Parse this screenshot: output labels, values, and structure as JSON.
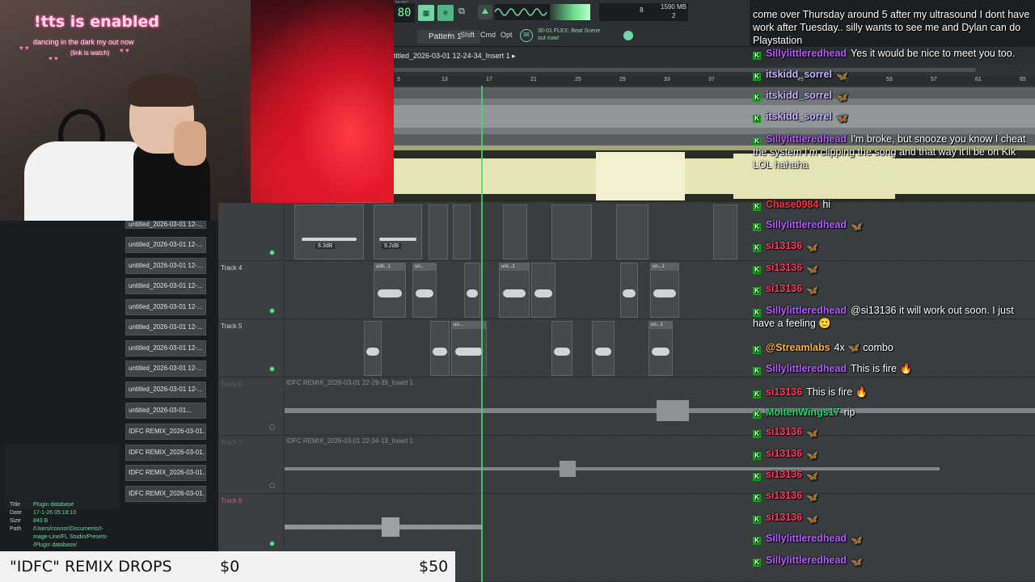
{
  "webcam": {
    "tts_title": "!tts is enabled",
    "tts_sub1": "dancing in the dark my out now",
    "tts_sub2": "(link is watch)"
  },
  "toolbar": {
    "tempo_caption": "MUSIC",
    "tempo": "80",
    "cpu_value": "8",
    "mem_value": "1590 MB",
    "voices_value": "2",
    "pattern_label": "Pattern 1",
    "pattern_add": "+",
    "shift_label": "Shift",
    "cmd_label": "Cmd",
    "opt_label": "Opt",
    "news_line1": "30-01  FLEX: Beat Scene",
    "news_line2": "out now!"
  },
  "playlist": {
    "title": "titled_2026-03-01 12-24-34_Insert 1 ▸",
    "ruler_ticks": [
      "9",
      "13",
      "17",
      "21",
      "25",
      "29",
      "33",
      "37",
      "41",
      "45",
      "49",
      "53",
      "57",
      "61",
      "65"
    ],
    "track_labels": [
      "Track 4",
      "Track 5",
      "Track 6",
      "Track 7",
      "Track 8"
    ],
    "clip_db1": "8.3dB",
    "clip_db2": "9.2dB",
    "clip_short1": "unti...1",
    "clip_short2": "un...",
    "clip_short3": "unt...1",
    "clip_short4": "un...1",
    "long_clip1": "IDFC REMIX_2026-03-01 22-29-39_Insert 1",
    "long_clip2": "IDFC REMIX_2026-03-01 22-34-13_Insert 1"
  },
  "browser": {
    "files": [
      "untitled_2026-03-01 12-...",
      "untitled_2026-03-01 12-...",
      "untitled_2026-03-01 12-...",
      "untitled_2026-03-01 12-...",
      "untitled_2026-03-01 12-...",
      "untitled_2026-03-01 12-...",
      "untitled_2026-03-01 12-...",
      "untitled_2026-03-01 12-...",
      "untitled_2026-03-01 12-...",
      "untitled_2026-03-01...",
      "IDFC REMIX_2026-03-01...",
      "IDFC REMIX_2026-03-01...",
      "IDFC REMIX_2026-03-01...",
      "IDFC REMIX_2026-03-01..."
    ],
    "meta_title_k": "Title",
    "meta_title_v": "Plugin database",
    "meta_date_k": "Date",
    "meta_date_v": "17-1-26 05:18:10",
    "meta_size_k": "Size",
    "meta_size_v": "843 B",
    "meta_path_k": "Path",
    "meta_path_v1": "/Users/connor/Documents/I-",
    "meta_path_v2": "mage-Line/FL Studio/Presets-",
    "meta_path_v3": "/Plugin database/"
  },
  "goal": {
    "title": "\"IDFC\" REMIX DROPS",
    "low": "$0",
    "high": "$50"
  },
  "chat": {
    "messages": [
      {
        "user": "",
        "text": "come over Thursday around 5 after my ultrasound I dont have work after Tuesday.. silly wants to see me and Dylan can do Playstation",
        "color": "#ffffff"
      },
      {
        "user": "Sillylittleredhead",
        "text": "Yes it would be nice to meet you too.",
        "color": "#b45cff"
      },
      {
        "user": "itskidd_sorrel",
        "text": "",
        "color": "#c7b3ff"
      },
      {
        "user": "itskidd_sorrel",
        "text": "",
        "color": "#c7b3ff"
      },
      {
        "user": "itskidd_sorrel",
        "text": "",
        "color": "#c7b3ff"
      },
      {
        "user": "Sillylittleredhead",
        "text": "I'm broke, but snooze you know I cheat the system I'm clipping the song and that way it'll be on Kik LOL hahaha",
        "color": "#b45cff"
      },
      {
        "user": "Chase0984",
        "text": "hi",
        "color": "#ff3040"
      },
      {
        "user": "Sillylittleredhead",
        "text": "",
        "color": "#b45cff"
      },
      {
        "user": "si13136",
        "text": "",
        "color": "#ff3a5a"
      },
      {
        "user": "si13136",
        "text": "",
        "color": "#ff3a5a"
      },
      {
        "user": "si13136",
        "text": "",
        "color": "#ff3a5a"
      },
      {
        "user": "Sillylittleredhead",
        "text": "@si13136 it will work out soon. I just have a feeling 🙂",
        "color": "#b45cff"
      },
      {
        "user": "@Streamlabs",
        "text": "4x 🦋 combo",
        "color": "#ffb347"
      },
      {
        "user": "Sillylittleredhead",
        "text": "This is fire 🔥",
        "color": "#b45cff"
      },
      {
        "user": "si13136",
        "text": "This is fire 🔥",
        "color": "#ff3a5a"
      },
      {
        "user": "MoltenWings17",
        "text": "rip",
        "color": "#27d36a"
      },
      {
        "user": "si13136",
        "text": "",
        "color": "#ff3a5a"
      },
      {
        "user": "si13136",
        "text": "",
        "color": "#ff3a5a"
      },
      {
        "user": "si13136",
        "text": "",
        "color": "#ff3a5a"
      },
      {
        "user": "si13136",
        "text": "",
        "color": "#ff3a5a"
      },
      {
        "user": "si13136",
        "text": "",
        "color": "#ff3a5a"
      },
      {
        "user": "Sillylittleredhead",
        "text": "",
        "color": "#b45cff"
      },
      {
        "user": "Sillylittleredhead",
        "text": "",
        "color": "#b45cff"
      }
    ]
  },
  "colors": {
    "accent_green": "#6ed8a2",
    "playhead": "#2ee86a",
    "waveform_yellow": "#e6e3b4"
  }
}
